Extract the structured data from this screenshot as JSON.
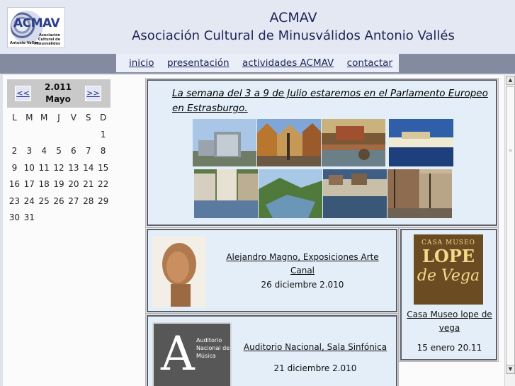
{
  "header": {
    "logo_text": "ACMAV",
    "logo_subtext": "Asociación Cultural de Minusválidos",
    "logo_subtext2": "Antonio Vallés",
    "title": "ACMAV",
    "subtitle": "Asociación Cultural de Minusválidos Antonio Vallés"
  },
  "nav": {
    "items": [
      {
        "label": "inicio"
      },
      {
        "label": "presentación"
      },
      {
        "label": "actividades ACMAV"
      },
      {
        "label": "contactar"
      }
    ]
  },
  "calendar": {
    "prev_label": "<<",
    "next_label": ">>",
    "year": "2.011",
    "month": "Mayo",
    "weekdays": [
      "L",
      "M",
      "M",
      "J",
      "V",
      "S",
      "D"
    ],
    "days": [
      "",
      "",
      "",
      "",
      "",
      "",
      "1",
      "2",
      "3",
      "4",
      "5",
      "6",
      "7",
      "8",
      "9",
      "10",
      "11",
      "12",
      "13",
      "14",
      "15",
      "16",
      "17",
      "18",
      "19",
      "20",
      "21",
      "22",
      "23",
      "24",
      "25",
      "26",
      "27",
      "28",
      "29",
      "30",
      "31"
    ]
  },
  "news": {
    "headline": "La semana del 3 a 9 de Julio estaremos en el Parlamento Europeo en Estrasburgo."
  },
  "cards": {
    "card1": {
      "title": "Alejandro Magno, Exposiciones Arte Canal",
      "date": "26 diciembre 2.010"
    },
    "card2": {
      "logo_line1": "CASA MUSEO",
      "logo_line2": "LOPE",
      "logo_line3": "de Vega",
      "title": "Casa Museo lope de vega",
      "date": "15 enero 20.11"
    },
    "card3": {
      "logo_letter": "A",
      "logo_text": "Auditorio Nacional de Música",
      "title": "Auditorio Nacional, Sala Sinfónica",
      "date": "21 diciembre 2.010"
    }
  },
  "colors": {
    "nav_band": "#848a9f",
    "nav_bg": "#e9eef8",
    "card_bg": "#e3eef8",
    "title_text": "#1c2454"
  },
  "icons": {
    "scroll_up": "▲",
    "scroll_down": "▼",
    "scroll_grip": "≡"
  }
}
